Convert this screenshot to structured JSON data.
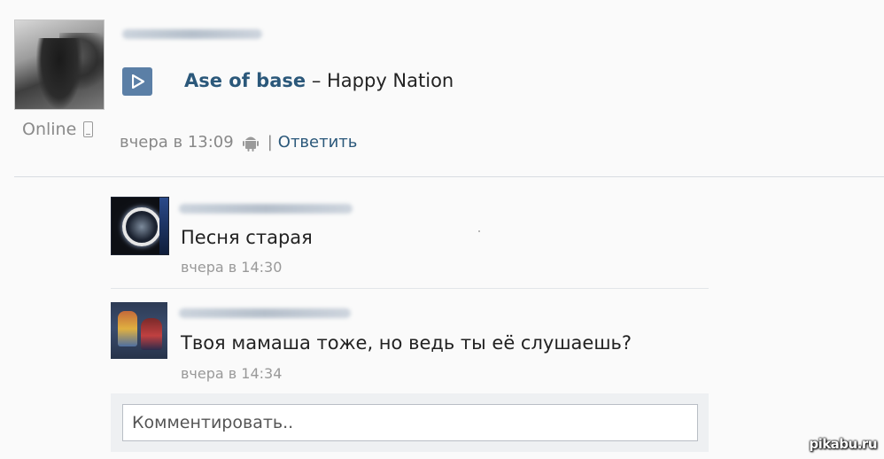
{
  "post": {
    "status": "Online",
    "track": {
      "artist": "Ase of base",
      "separator": " – ",
      "title": "Happy Nation"
    },
    "time": "вчера в 13:09",
    "divider": "|",
    "reply_label": "Ответить"
  },
  "comments": [
    {
      "text": "Песня старая",
      "time": "вчера в 14:30"
    },
    {
      "text": "Твоя мамаша тоже, но ведь ты её слушаешь?",
      "time": "вчера в 14:34"
    }
  ],
  "comment_box": {
    "placeholder": "Комментировать.."
  },
  "watermark": "pikabu.ru",
  "colors": {
    "link": "#2b587a",
    "play_button": "#5b7fa6",
    "meta": "#888888"
  },
  "icons": [
    "phone-icon",
    "play-icon",
    "android-icon"
  ]
}
